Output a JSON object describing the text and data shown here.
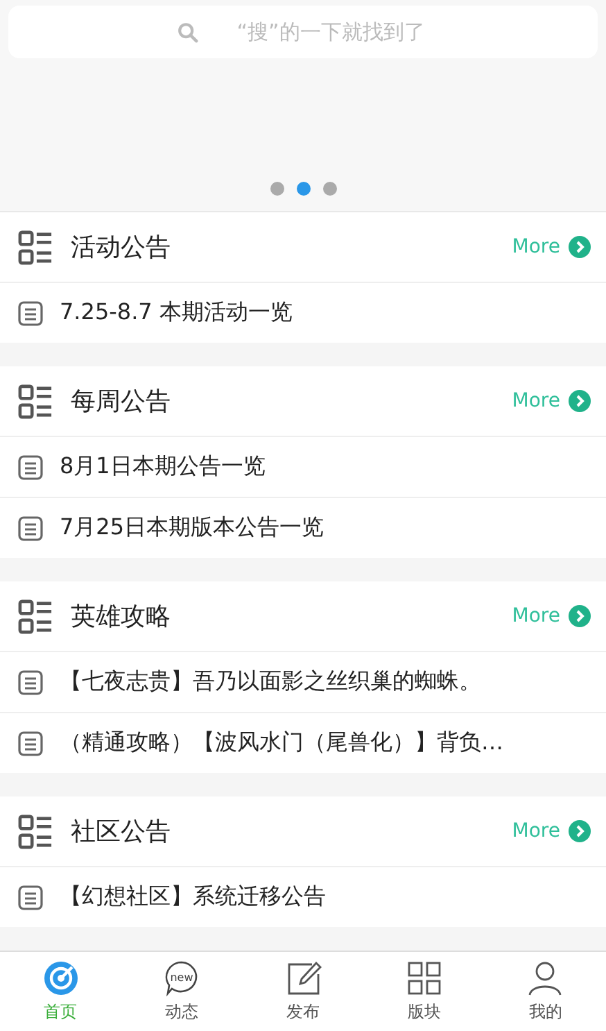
{
  "search": {
    "placeholder": "“搜”的一下就找到了"
  },
  "banner": {
    "dots": [
      {
        "selected": false
      },
      {
        "selected": true
      },
      {
        "selected": false
      }
    ]
  },
  "sections": [
    {
      "title": "活动公告",
      "more": "More",
      "items": [
        "7.25-8.7 本期活动一览"
      ]
    },
    {
      "title": "每周公告",
      "more": "More",
      "items": [
        "8月1日本期公告一览",
        "7月25日本期版本公告一览"
      ]
    },
    {
      "title": "英雄攻略",
      "more": "More",
      "items": [
        "【七夜志贵】吾乃以面影之丝织巢的蜘蛛。",
        "（精通攻略）【波风水门（尾兽化）】背负…"
      ]
    },
    {
      "title": "社区公告",
      "more": "More",
      "items": [
        "【幻想社区】系统迁移公告"
      ]
    }
  ],
  "tabs": [
    {
      "kind": "home",
      "label": "首页",
      "selected": true
    },
    {
      "kind": "news",
      "label": "动态",
      "icon_text": "new",
      "selected": false
    },
    {
      "kind": "post",
      "label": "发布",
      "selected": false
    },
    {
      "kind": "board",
      "label": "版块",
      "selected": false
    },
    {
      "kind": "me",
      "label": "我的",
      "selected": false
    }
  ]
}
